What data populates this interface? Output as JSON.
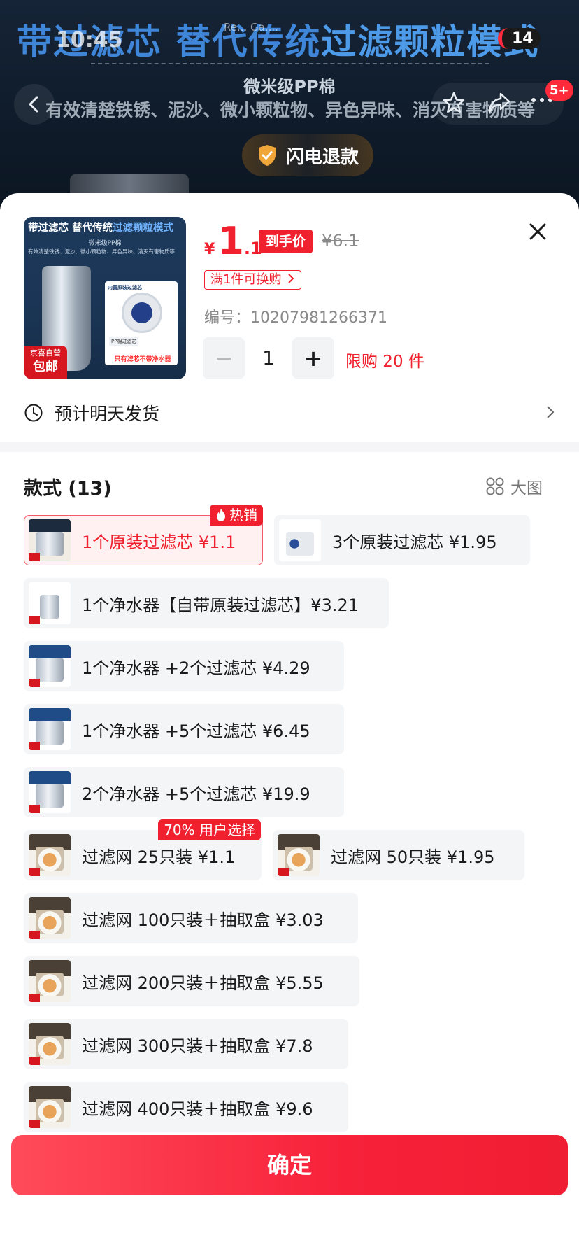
{
  "banner": {
    "title_part1": "带过滤芯 替代传统",
    "title_part2": "过滤颗粒模式",
    "subtitle": "微米级PP棉",
    "description": "有效清楚铁锈、泥沙、微小颗粒物、异色异味、消灭有害物质等",
    "refund_label": "闪电退款"
  },
  "status_bar": {
    "time": "10:45",
    "badge": "14",
    "noise": "Re... Ga...."
  },
  "nav": {
    "cart_count": "5+"
  },
  "product": {
    "thumb": {
      "title_part1": "带过滤芯 替代传统",
      "title_part2": "过滤颗粒模式",
      "subtitle": "微米级PP棉",
      "desc": "有效清楚铁锈、泥沙、微小颗粒物、异色异味、消灭有害物质等",
      "card_label": "内置原装过滤芯",
      "card_tag": "PP棉过滤芯",
      "warning": "只有滤芯不带净水器",
      "badge_line1": "京喜自营",
      "badge_line2": "包邮"
    },
    "price_symbol": "¥",
    "price_int": "1",
    "price_dec": ".1",
    "price_tag": "到手价",
    "original_price": "¥6.1",
    "promo": "满1件可换购",
    "sku_label": "编号：",
    "sku_value": "10207981266371",
    "quantity": "1",
    "minus": "−",
    "plus": "+",
    "limit": "限购 20 件"
  },
  "shipping": {
    "text": "预计明天发货"
  },
  "options": {
    "title": "款式 (13)",
    "big_image_label": "大图",
    "items": [
      {
        "label": "1个原装过滤芯  ¥1.1",
        "badge": "热销",
        "selected": true
      },
      {
        "label": "3个原装过滤芯  ¥1.95"
      },
      {
        "label": "1个净水器【自带原装过滤芯】¥3.21"
      },
      {
        "label": "1个净水器 +2个过滤芯  ¥4.29"
      },
      {
        "label": "1个净水器 +5个过滤芯  ¥6.45"
      },
      {
        "label": "2个净水器 +5个过滤芯  ¥19.9"
      },
      {
        "label": "过滤网 25只装  ¥1.1",
        "badge": "70% 用户选择"
      },
      {
        "label": "过滤网 50只装  ¥1.95"
      },
      {
        "label": "过滤网 100只装＋抽取盒  ¥3.03"
      },
      {
        "label": "过滤网 200只装＋抽取盒  ¥5.55"
      },
      {
        "label": "过滤网 300只装＋抽取盒  ¥7.8"
      },
      {
        "label": "过滤网 400只装＋抽取盒  ¥9.6"
      }
    ]
  },
  "confirm_label": "确定",
  "colors": {
    "accent": "#f0202e",
    "chip_bg": "#f4f5f7",
    "selected_bg": "#fff1f1"
  }
}
